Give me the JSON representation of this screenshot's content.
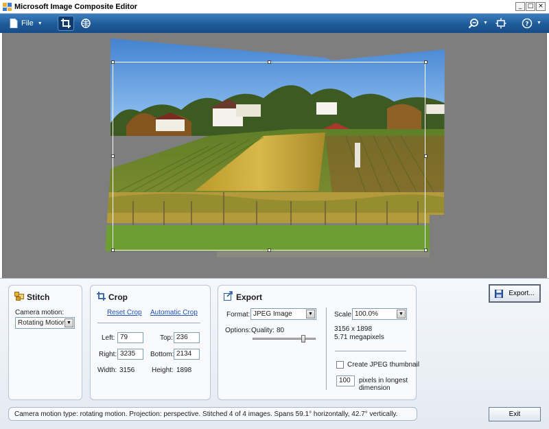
{
  "window": {
    "title": "Microsoft Image Composite Editor",
    "controls": {
      "minimize": "_",
      "maximize": "□",
      "close": "×"
    }
  },
  "toolbar": {
    "file_label": "File",
    "icons": [
      "new-file-icon",
      "crop-tool-icon",
      "projection-tool-icon",
      "zoom-icon",
      "fit-view-icon",
      "help-icon"
    ]
  },
  "stitch": {
    "title": "Stitch",
    "camera_motion_label": "Camera motion:",
    "camera_motion_value": "Rotating Motion"
  },
  "crop": {
    "title": "Crop",
    "reset_link": "Reset Crop",
    "auto_link": "Automatic Crop",
    "left_label": "Left:",
    "left_value": "79",
    "top_label": "Top:",
    "top_value": "236",
    "right_label": "Right:",
    "right_value": "3235",
    "bottom_label": "Bottom:",
    "bottom_value": "2134",
    "width_label": "Width:",
    "width_value": "3156",
    "height_label": "Height:",
    "height_value": "1898"
  },
  "export": {
    "title": "Export",
    "format_label": "Format:",
    "format_value": "JPEG Image",
    "options_label": "Options:",
    "quality_label": "Quality:",
    "quality_value": "80",
    "quality_fraction": 0.8,
    "scale_label": "Scale:",
    "scale_value": "100.0%",
    "dimensions": "3156 x 1898",
    "megapixels": "5.71 megapixels",
    "thumbnail_label": "Create JPEG thumbnail",
    "thumbnail_checked": false,
    "pixels_value": "100",
    "pixels_label_1": "pixels in longest",
    "pixels_label_2": "dimension"
  },
  "buttons": {
    "export": "Export...",
    "exit": "Exit"
  },
  "status": "Camera motion type: rotating motion. Projection: perspective. Stitched 4 of 4 images. Spans 59.1° horizontally, 42.7° vertically.",
  "colors": {
    "toolbar": "#1e5a99",
    "canvas": "#7e7e7e",
    "sky": "#4f8fd8",
    "vineyard": "#6a8a2a",
    "link": "#1f4fb4"
  }
}
